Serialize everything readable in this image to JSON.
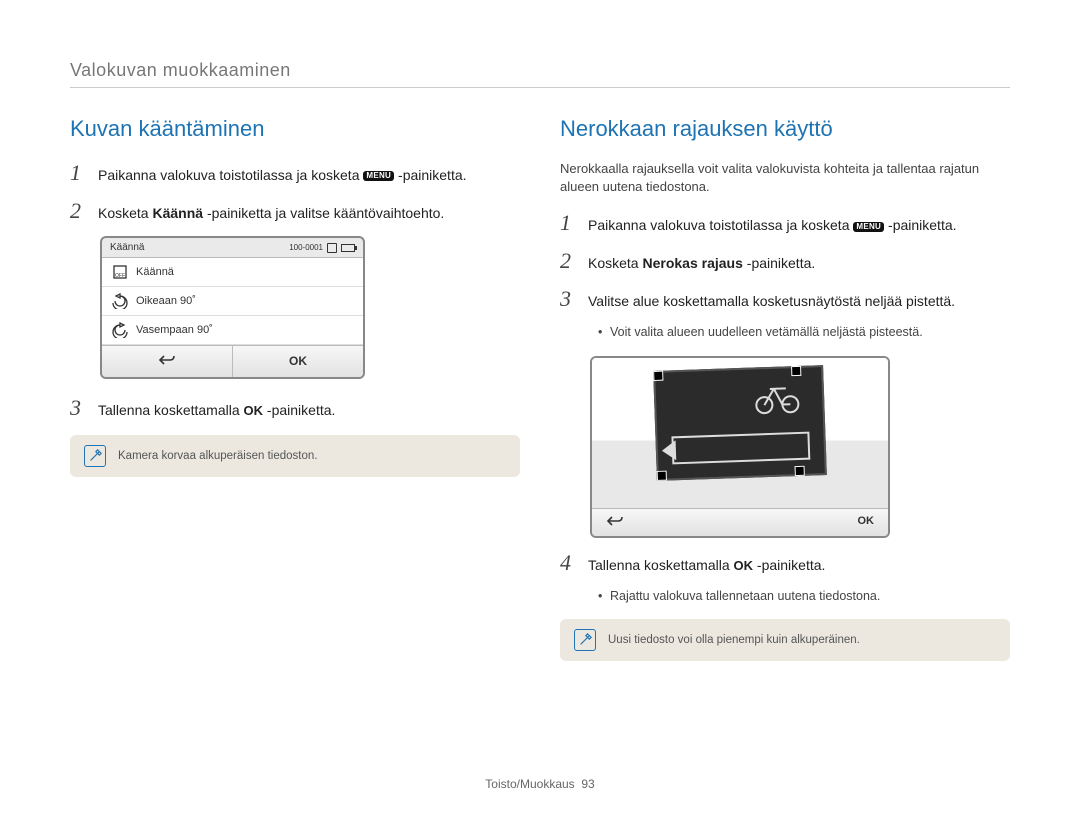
{
  "header": {
    "title": "Valokuvan muokkaaminen"
  },
  "left": {
    "heading": "Kuvan kääntäminen",
    "steps": [
      {
        "num": "1",
        "pre": "Paikanna valokuva toistotilassa ja kosketa ",
        "menu": "MENU",
        "post": " -painiketta."
      },
      {
        "num": "2",
        "pre": "Kosketa ",
        "bold": "Käännä",
        "post": "-painiketta ja valitse kääntövaihtoehto."
      },
      {
        "num": "3",
        "pre": "Tallenna koskettamalla ",
        "ok": "OK",
        "post": " -painiketta."
      }
    ],
    "screen": {
      "title": "Käännä",
      "counter": "100-0001",
      "items": [
        {
          "label": "Käännä",
          "kind": "rotate"
        },
        {
          "label": "Oikeaan 90˚",
          "kind": "cw"
        },
        {
          "label": "Vasempaan 90˚",
          "kind": "ccw"
        }
      ],
      "ok": "OK"
    },
    "note": "Kamera korvaa alkuperäisen tiedoston."
  },
  "right": {
    "heading": "Nerokkaan rajauksen käyttö",
    "intro": "Nerokkaalla rajauksella voit valita valokuvista kohteita ja tallentaa rajatun alueen uutena tiedostona.",
    "steps": [
      {
        "num": "1",
        "pre": "Paikanna valokuva toistotilassa ja kosketa ",
        "menu": "MENU",
        "post": " -painiketta."
      },
      {
        "num": "2",
        "pre": "Kosketa ",
        "bold": "Nerokas rajaus",
        "post": " -painiketta."
      },
      {
        "num": "3",
        "text": "Valitse alue koskettamalla kosketusnäytöstä neljää pistettä."
      },
      {
        "num": "4",
        "pre": "Tallenna koskettamalla ",
        "ok": "OK",
        "post": " -painiketta."
      }
    ],
    "bullet3": "Voit valita alueen uudelleen vetämällä neljästä pisteestä.",
    "bullet4": "Rajattu valokuva tallennetaan uutena tiedostona.",
    "screen": {
      "ok": "OK"
    },
    "note": "Uusi tiedosto voi olla pienempi kuin alkuperäinen."
  },
  "footer": {
    "section": "Toisto/Muokkaus",
    "page": "93"
  }
}
